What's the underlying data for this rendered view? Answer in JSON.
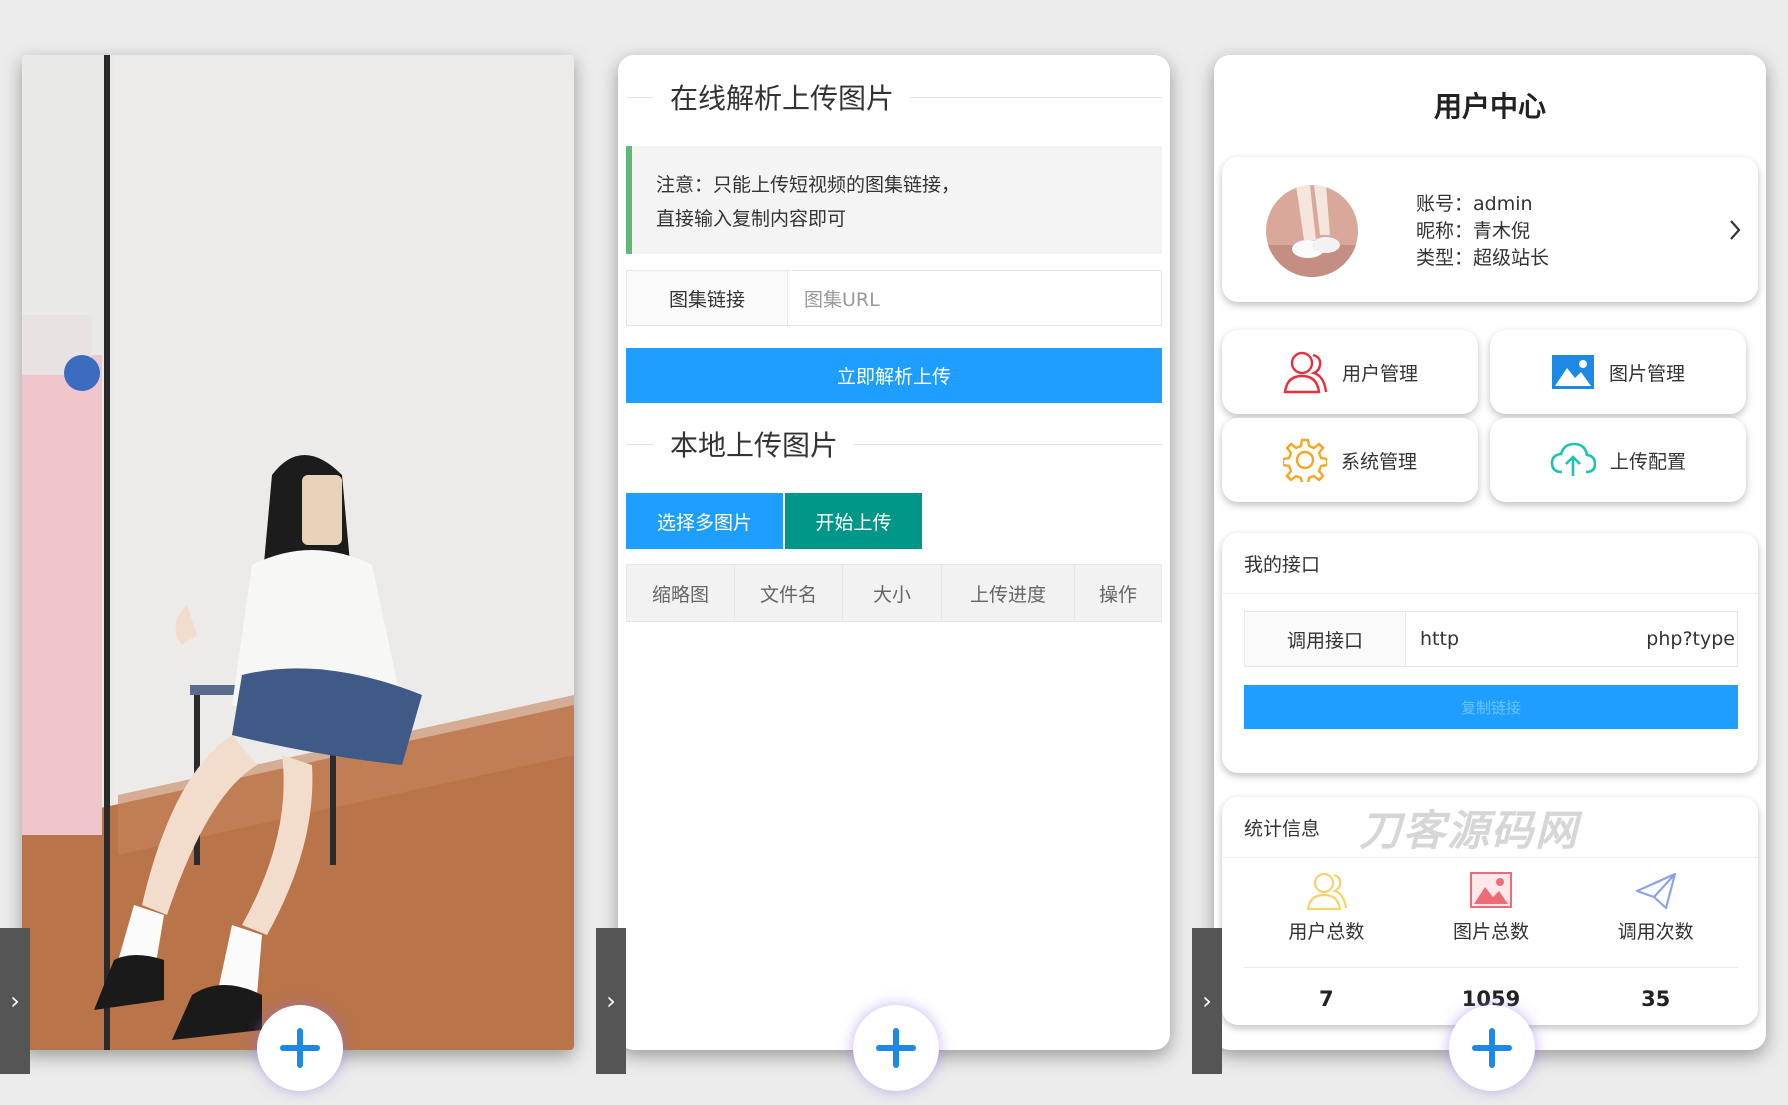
{
  "upload_page": {
    "online_section_title": "在线解析上传图片",
    "notice_line1": "注意：只能上传短视频的图集链接，",
    "notice_line2": "直接输入复制内容即可",
    "album_link_label": "图集链接",
    "album_url_placeholder": "图集URL",
    "parse_upload_button": "立即解析上传",
    "local_section_title": "本地上传图片",
    "select_multi_button": "选择多图片",
    "start_upload_button": "开始上传",
    "table_headers": [
      "缩略图",
      "文件名",
      "大小",
      "上传进度",
      "操作"
    ]
  },
  "user_center": {
    "title": "用户中心",
    "account_line": "账号：admin",
    "nickname_line": "昵称：青木倪",
    "type_line": "类型：超级站长",
    "menu": {
      "user_management": "用户管理",
      "image_management": "图片管理",
      "system_management": "系统管理",
      "upload_config": "上传配置"
    },
    "my_api_title": "我的接口",
    "api_label": "调用接口",
    "api_value_start": "http",
    "api_value_end": "php?type",
    "api_button_label": "复制链接",
    "stats_title": "统计信息",
    "watermark": "刀客源码网",
    "stats": [
      {
        "label": "用户总数",
        "value": "7"
      },
      {
        "label": "图片总数",
        "value": "1059"
      },
      {
        "label": "调用次数",
        "value": "35"
      }
    ]
  },
  "colors": {
    "primary_blue": "#1e9fff",
    "teal": "#009688",
    "notice_green": "#5fb878",
    "user_icon_red": "#e8303b",
    "gear_orange": "#f5a623",
    "cloud_teal": "#19c4b0",
    "image_icon_blue": "#1e88e5"
  },
  "icons": [
    "chevron-right-icon",
    "plus-icon",
    "user-icon",
    "image-icon",
    "gear-icon",
    "cloud-upload-icon",
    "send-icon"
  ]
}
